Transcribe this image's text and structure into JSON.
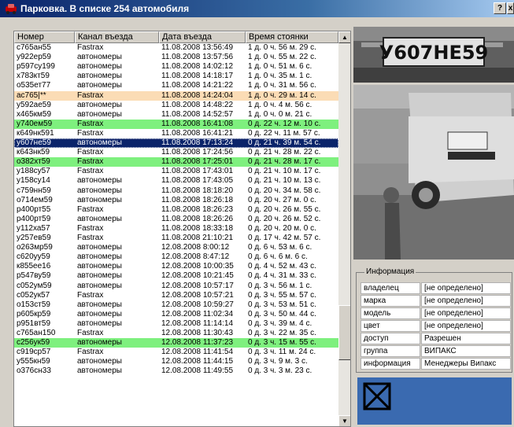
{
  "window": {
    "title": "Парковка. В списке 254 автомобиля",
    "help_button": "?",
    "close_button": "x"
  },
  "table": {
    "columns": [
      "Номер",
      "Канал въезда",
      "Дата въезда",
      "Время стоянки"
    ],
    "rows": [
      {
        "number": "с765ан55",
        "channel": "Fastrax",
        "date": "11.08.2008 13:56:49",
        "duration": "1 д. 0 ч. 56 м. 29 с.",
        "state": "normal"
      },
      {
        "number": "у922ер59",
        "channel": "автономеры",
        "date": "11.08.2008 13:57:56",
        "duration": "1 д. 0 ч. 55 м. 22 с.",
        "state": "normal"
      },
      {
        "number": "р597су199",
        "channel": "автономеры",
        "date": "11.08.2008 14:02:12",
        "duration": "1 д. 0 ч. 51 м. 6 с.",
        "state": "normal"
      },
      {
        "number": "х783кт59",
        "channel": "автономеры",
        "date": "11.08.2008 14:18:17",
        "duration": "1 д. 0 ч. 35 м. 1 с.",
        "state": "normal"
      },
      {
        "number": "о535ет77",
        "channel": "автономеры",
        "date": "11.08.2008 14:21:22",
        "duration": "1 д. 0 ч. 31 м. 56 с.",
        "state": "normal"
      },
      {
        "number": "ас765|**",
        "channel": "Fastrax",
        "date": "11.08.2008 14:24:04",
        "duration": "1 д. 0 ч. 29 м. 14 с.",
        "state": "orange"
      },
      {
        "number": "у592ае59",
        "channel": "автономеры",
        "date": "11.08.2008 14:48:22",
        "duration": "1 д. 0 ч. 4 м. 56 с.",
        "state": "normal"
      },
      {
        "number": "х465км59",
        "channel": "автономеры",
        "date": "11.08.2008 14:52:57",
        "duration": "1 д. 0 ч. 0 м. 21 с.",
        "state": "normal"
      },
      {
        "number": "у740ем59",
        "channel": "Fastrax",
        "date": "11.08.2008 16:41:08",
        "duration": "0 д. 22 ч. 12 м. 10 с.",
        "state": "green"
      },
      {
        "number": "к649нк591",
        "channel": "Fastrax",
        "date": "11.08.2008 16:41:21",
        "duration": "0 д. 22 ч. 11 м. 57 с.",
        "state": "normal"
      },
      {
        "number": "у607не59",
        "channel": "автономеры",
        "date": "11.08.2008 17:13:24",
        "duration": "0 д. 21 ч. 39 м. 54 с.",
        "state": "selected"
      },
      {
        "number": "к643нк59",
        "channel": "Fastrax",
        "date": "11.08.2008 17:24:56",
        "duration": "0 д. 21 ч. 28 м. 22 с.",
        "state": "normal"
      },
      {
        "number": "о382хт59",
        "channel": "Fastrax",
        "date": "11.08.2008 17:25:01",
        "duration": "0 д. 21 ч. 28 м. 17 с.",
        "state": "green"
      },
      {
        "number": "у188су57",
        "channel": "Fastrax",
        "date": "11.08.2008 17:43:01",
        "duration": "0 д. 21 ч. 10 м. 17 с.",
        "state": "normal"
      },
      {
        "number": "у158су14",
        "channel": "автономеры",
        "date": "11.08.2008 17:43:05",
        "duration": "0 д. 21 ч. 10 м. 13 с.",
        "state": "normal"
      },
      {
        "number": "с759нн59",
        "channel": "автономеры",
        "date": "11.08.2008 18:18:20",
        "duration": "0 д. 20 ч. 34 м. 58 с.",
        "state": "normal"
      },
      {
        "number": "о714ем59",
        "channel": "автономеры",
        "date": "11.08.2008 18:26:18",
        "duration": "0 д. 20 ч. 27 м. 0 с.",
        "state": "normal"
      },
      {
        "number": "р400рт55",
        "channel": "Fastrax",
        "date": "11.08.2008 18:26:23",
        "duration": "0 д. 20 ч. 26 м. 55 с.",
        "state": "normal"
      },
      {
        "number": "р400рт59",
        "channel": "автономеры",
        "date": "11.08.2008 18:26:26",
        "duration": "0 д. 20 ч. 26 м. 52 с.",
        "state": "normal"
      },
      {
        "number": "у112ха57",
        "channel": "Fastrax",
        "date": "11.08.2008 18:33:18",
        "duration": "0 д. 20 ч. 20 м. 0 с.",
        "state": "normal"
      },
      {
        "number": "у257ев59",
        "channel": "Fastrax",
        "date": "11.08.2008 21:10:21",
        "duration": "0 д. 17 ч. 42 м. 57 с.",
        "state": "normal"
      },
      {
        "number": "о263мр59",
        "channel": "автономеры",
        "date": "12.08.2008 8:00:12",
        "duration": "0 д. 6 ч. 53 м. 6 с.",
        "state": "normal"
      },
      {
        "number": "с620уу59",
        "channel": "автономеры",
        "date": "12.08.2008 8:47:12",
        "duration": "0 д. 6 ч. 6 м. 6 с.",
        "state": "normal"
      },
      {
        "number": "к855ее16",
        "channel": "автономеры",
        "date": "12.08.2008 10:00:35",
        "duration": "0 д. 4 ч. 52 м. 43 с.",
        "state": "normal"
      },
      {
        "number": "р547ву59",
        "channel": "автономеры",
        "date": "12.08.2008 10:21:45",
        "duration": "0 д. 4 ч. 31 м. 33 с.",
        "state": "normal"
      },
      {
        "number": "с052ум59",
        "channel": "автономеры",
        "date": "12.08.2008 10:57:17",
        "duration": "0 д. 3 ч. 56 м. 1 с.",
        "state": "normal"
      },
      {
        "number": "с052ук57",
        "channel": "Fastrax",
        "date": "12.08.2008 10:57:21",
        "duration": "0 д. 3 ч. 55 м. 57 с.",
        "state": "normal"
      },
      {
        "number": "о153ст59",
        "channel": "автономеры",
        "date": "12.08.2008 10:59:27",
        "duration": "0 д. 3 ч. 53 м. 51 с.",
        "state": "normal"
      },
      {
        "number": "р605кр59",
        "channel": "автономеры",
        "date": "12.08.2008 11:02:34",
        "duration": "0 д. 3 ч. 50 м. 44 с.",
        "state": "normal"
      },
      {
        "number": "р951вт59",
        "channel": "автономеры",
        "date": "12.08.2008 11:14:14",
        "duration": "0 д. 3 ч. 39 м. 4 с.",
        "state": "normal"
      },
      {
        "number": "с765ан150",
        "channel": "Fastrax",
        "date": "12.08.2008 11:30:43",
        "duration": "0 д. 3 ч. 22 м. 35 с.",
        "state": "normal"
      },
      {
        "number": "с256ук59",
        "channel": "автономеры",
        "date": "12.08.2008 11:37:23",
        "duration": "0 д. 3 ч. 15 м. 55 с.",
        "state": "green"
      },
      {
        "number": "с919ср57",
        "channel": "Fastrax",
        "date": "12.08.2008 11:41:54",
        "duration": "0 д. 3 ч. 11 м. 24 с.",
        "state": "normal"
      },
      {
        "number": "у555кн59",
        "channel": "автономеры",
        "date": "12.08.2008 11:44:15",
        "duration": "0 д. 3 ч. 9 м. 3 с.",
        "state": "normal"
      },
      {
        "number": "о376сн33",
        "channel": "автономеры",
        "date": "12.08.2008 11:49:55",
        "duration": "0 д. 3 ч. 3 м. 23 с.",
        "state": "normal"
      }
    ]
  },
  "plate_image": {
    "text": "У607НЕ59"
  },
  "info": {
    "legend": "Информация",
    "rows": [
      {
        "key": "владелец",
        "value": "[не определено]"
      },
      {
        "key": "марка",
        "value": "[не определено]"
      },
      {
        "key": "модель",
        "value": "[не определено]"
      },
      {
        "key": "цвет",
        "value": "[не определено]"
      },
      {
        "key": "доступ",
        "value": "Разрешен"
      },
      {
        "key": "группа",
        "value": "ВИПАКС"
      },
      {
        "key": "информация",
        "value": "Менеджеры Випакс"
      }
    ]
  },
  "colors": {
    "title_bar": "#0a246a",
    "row_green": "#7ef07e",
    "row_orange": "#fbdcb5",
    "row_selected": "#0a246a",
    "info_panel": "#3a6ab0"
  },
  "icons": [
    "app-icon",
    "help-icon",
    "close-icon",
    "scroll-up-icon",
    "scroll-down-icon",
    "no-image-icon"
  ]
}
